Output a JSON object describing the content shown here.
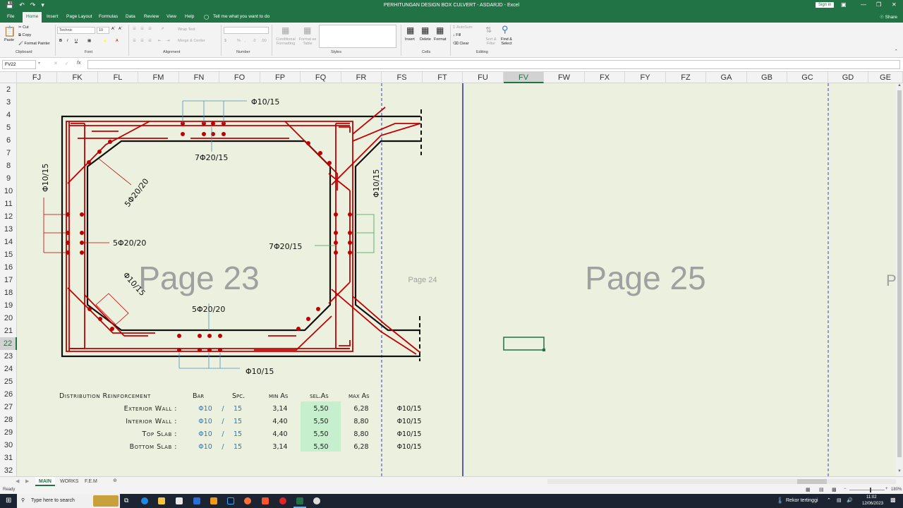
{
  "window": {
    "title": "PERHITUNGAN DESIGN BOX CULVERT - ASDARJD  -  Excel",
    "sign_in": "Sign in"
  },
  "menu": {
    "tabs": [
      "File",
      "Home",
      "Insert",
      "Page Layout",
      "Formulas",
      "Data",
      "Review",
      "View",
      "Help"
    ],
    "tell_me": "Tell me what you want to do",
    "share": "Share"
  },
  "ribbon": {
    "paste": "Paste",
    "cut": "Cut",
    "copy": "Copy",
    "format_painter": "Format Painter",
    "clipboard": "Clipboard",
    "font_name": "Technic",
    "font_size": "10",
    "font": "Font",
    "wrap_text": "Wrap Text",
    "merge_center": "Merge & Center",
    "alignment": "Alignment",
    "number": "Number",
    "conditional_formatting": "Conditional Formatting",
    "format_as_table": "Format as Table",
    "styles": "Styles",
    "insert": "Insert",
    "delete": "Delete",
    "format": "Format",
    "cells": "Cells",
    "autosum": "AutoSum",
    "fill": "Fill",
    "clear": "Clear",
    "sort_filter": "Sort & Filter",
    "find_select": "Find & Select",
    "editing": "Editing"
  },
  "formula_bar": {
    "name_box": "FV22",
    "fx": "fx",
    "value": ""
  },
  "columns": [
    "FJ",
    "FK",
    "FL",
    "FM",
    "FN",
    "FO",
    "FP",
    "FQ",
    "FR",
    "FS",
    "FT",
    "FU",
    "FV",
    "FW",
    "FX",
    "FY",
    "FZ",
    "GA",
    "GB",
    "GC",
    "GD",
    "GE"
  ],
  "selected_column": "FV",
  "rows": [
    "2",
    "3",
    "4",
    "5",
    "6",
    "7",
    "8",
    "9",
    "10",
    "11",
    "12",
    "13",
    "14",
    "15",
    "16",
    "17",
    "18",
    "19",
    "20",
    "21",
    "22",
    "23",
    "24",
    "25",
    "26",
    "27",
    "28",
    "29",
    "30",
    "31",
    "32"
  ],
  "selected_row": "22",
  "watermarks": {
    "page23": "Page 23",
    "page24": "Page 24",
    "page25": "Page 25",
    "page26_partial": "P"
  },
  "drawing_labels": {
    "top_stirrup": "Φ10/15",
    "top_bars": "7Φ20/15",
    "haunch_bars": "5Φ20/20",
    "left_wall_stirrup": "Φ10/15",
    "left_wall_bars": "5Φ20/20",
    "right_wall_bars": "7Φ20/15",
    "right_wall_stirrup": "Φ10/15",
    "bottom_haunch": "Φ10/15",
    "bottom_bars": "5Φ20/20",
    "bottom_stirrup": "Φ10/15"
  },
  "dist_table": {
    "title": "Distribution Reinforcement",
    "headers": {
      "bar": "Bar",
      "spc": "Spc.",
      "min_as": "min As",
      "sel_as": "sel.As",
      "max_as": "max As"
    },
    "rows": [
      {
        "label": "Exterior Wall :",
        "bar": "Φ10",
        "slash": "/",
        "spc": "15",
        "min": "3,14",
        "sel": "5,50",
        "max": "6,28",
        "result": "Φ10/15"
      },
      {
        "label": "Interior Wall :",
        "bar": "Φ10",
        "slash": "/",
        "spc": "15",
        "min": "4,40",
        "sel": "5,50",
        "max": "8,80",
        "result": "Φ10/15"
      },
      {
        "label": "Top Slab :",
        "bar": "Φ10",
        "slash": "/",
        "spc": "15",
        "min": "4,40",
        "sel": "5,50",
        "max": "8,80",
        "result": "Φ10/15"
      },
      {
        "label": "Bottom Slab :",
        "bar": "Φ10",
        "slash": "/",
        "spc": "15",
        "min": "3,14",
        "sel": "5,50",
        "max": "6,28",
        "result": "Φ10/15"
      }
    ]
  },
  "sheets": [
    "MAIN",
    "WORKS",
    "F.E.M"
  ],
  "active_sheet": "MAIN",
  "status": {
    "ready": "Ready",
    "zoom": "180%"
  },
  "taskbar": {
    "search": "Type here to search",
    "weather": "Rekor tertinggi",
    "time": "11:02",
    "date": "12/06/2023"
  },
  "colors": {
    "excel_green": "#217346",
    "sheet_bg": "#ebf1de",
    "rebar": "#c00000",
    "sel_cell_fill": "#c6efce",
    "bar_blue": "#2f75b5"
  }
}
